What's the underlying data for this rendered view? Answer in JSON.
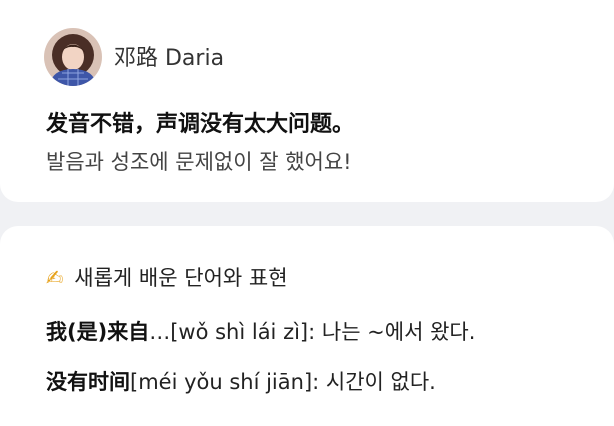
{
  "comment": {
    "author": "邓路 Daria",
    "avatar": "avatar",
    "feedback_zh": "发音不错，声调没有太大问题。",
    "feedback_ko": "발음과 성조에 문제없이 잘 했어요!"
  },
  "vocab": {
    "title_icon": "writing-hand-icon",
    "title": "새롭게 배운 단어와 표현",
    "items": [
      {
        "term": "我(是)来自",
        "rest": "…[wǒ shì lái zì]: 나는 ~에서 왔다."
      },
      {
        "term": "没有时间",
        "rest": "[méi yǒu shí jiān]: 시간이 없다."
      }
    ]
  }
}
